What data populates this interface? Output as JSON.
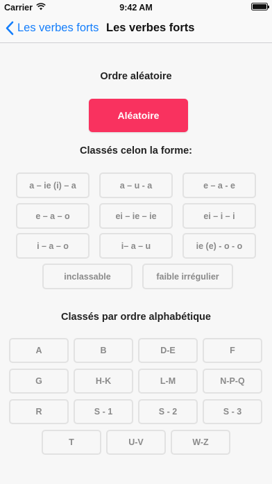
{
  "status_bar": {
    "carrier": "Carrier",
    "time": "9:42 AM"
  },
  "nav": {
    "back_label": "Les verbes forts",
    "title": "Les verbes forts"
  },
  "random_section": {
    "title": "Ordre aléatoire",
    "button_label": "Aléatoire"
  },
  "forme_section": {
    "title": "Classés celon la forme:",
    "items": [
      "a – ie (i) – a",
      "a – u - a",
      "e – a - e",
      "e – a – o",
      "ei – ie – ie",
      "ei – i – i",
      "i – a – o",
      "i– a – u",
      "ie (e) - o - o",
      "inclassable",
      "faible irrégulier"
    ]
  },
  "alpha_section": {
    "title": "Classés par ordre alphabétique",
    "items": [
      "A",
      "B",
      "D-E",
      "F",
      "G",
      "H-K",
      "L-M",
      "N-P-Q",
      "R",
      "S - 1",
      "S - 2",
      "S - 3",
      "T",
      "U-V",
      "W-Z"
    ]
  },
  "colors": {
    "accent_blue": "#147efb",
    "random_button": "#f9325f",
    "button_border": "#e2e2e2",
    "button_text": "#8a8a8a"
  },
  "icons": [
    "wifi-icon",
    "battery-icon",
    "chevron-left-icon"
  ]
}
